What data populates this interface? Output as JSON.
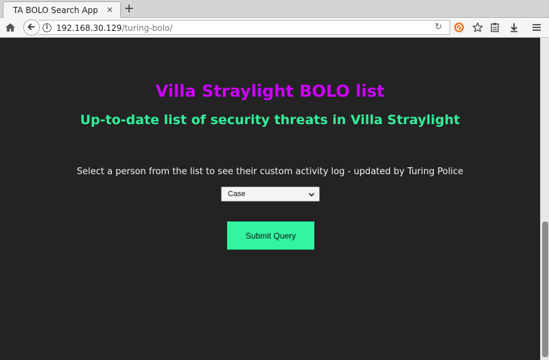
{
  "browser": {
    "tab_title": "TA BOLO Search App",
    "tab_close": "×",
    "new_tab": "+",
    "url_host": "192.168.30.129",
    "url_path": "/turing-bolo/",
    "reload": "↻"
  },
  "page": {
    "title": "Villa Straylight BOLO list",
    "subtitle": "Up-to-date list of security threats in Villa Straylight",
    "instructions": "Select a person from the list to see their custom activity log - updated by Turing Police",
    "select_value": "Case",
    "submit_label": "Submit Query"
  },
  "colors": {
    "background": "#232323",
    "title": "#cc00ff",
    "subtitle": "#33ee99",
    "button": "#33f5a0"
  }
}
